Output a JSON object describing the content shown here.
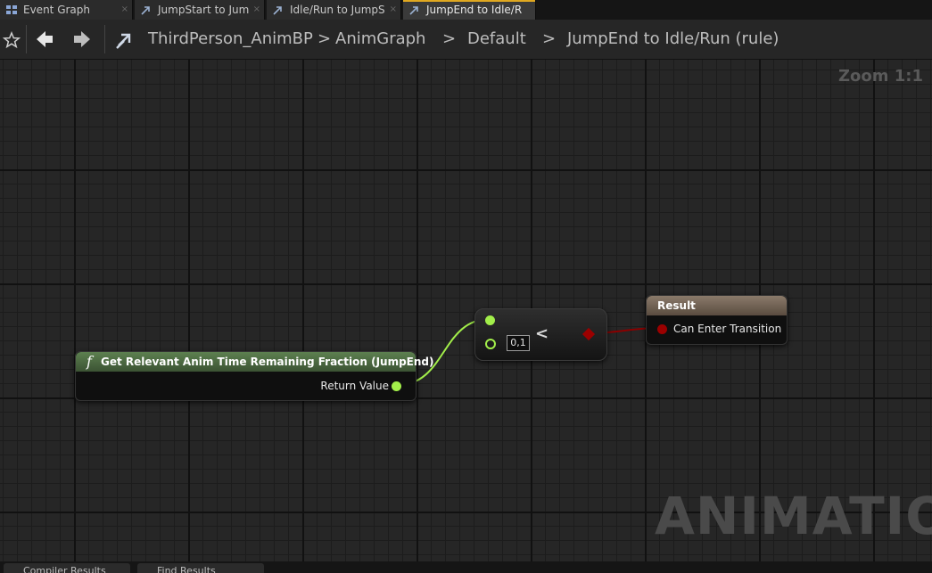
{
  "tabs": [
    {
      "label": "Event Graph",
      "icon": "event-graph-icon",
      "close": "×"
    },
    {
      "label": "JumpStart to Jum",
      "icon": "transition-icon",
      "close": "×"
    },
    {
      "label": "Idle/Run to JumpS",
      "icon": "transition-icon",
      "close": "×"
    },
    {
      "label": "JumpEnd to Idle/R",
      "icon": "transition-icon",
      "close": "×"
    }
  ],
  "breadcrumb": {
    "items": [
      "ThirdPerson_AnimBP",
      "AnimGraph",
      "Default",
      "JumpEnd to Idle/Run (rule)"
    ],
    "separator": ">"
  },
  "zoom": "Zoom 1:1",
  "nodes": {
    "get_time": {
      "icon_glyph": "f",
      "title": "Get Relevant Anim Time Remaining Fraction (JumpEnd)",
      "output_label": "Return Value"
    },
    "compare": {
      "operator": "<",
      "default_value": "0,1"
    },
    "result": {
      "title": "Result",
      "input_label": "Can Enter Transition"
    }
  },
  "watermark": "ANIMATION",
  "bottom_tabs": [
    "Compiler Results",
    "Find Results"
  ],
  "colors": {
    "float_pin": "#a2ee4a",
    "bool_pin": "#9b0000",
    "function_header": "#4b6b40",
    "result_header": "#7a6a5a",
    "active_tab_accent": "#e0a820"
  }
}
